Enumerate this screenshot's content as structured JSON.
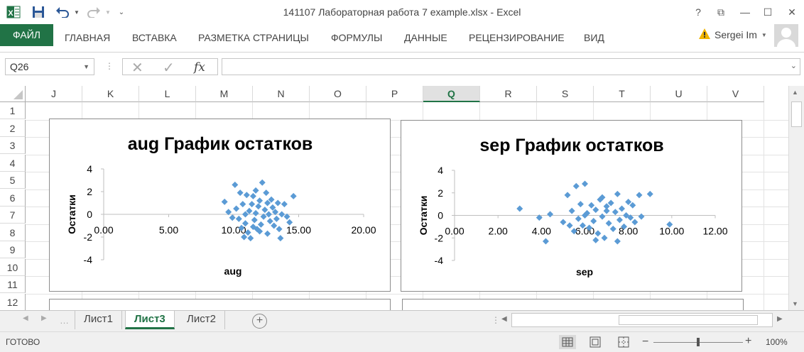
{
  "window": {
    "title": "141107 Лабораторная работа 7 example.xlsx - Excel",
    "help": "?",
    "restore_ribbon": "⧉",
    "minimize": "—",
    "maximize": "☐",
    "close": "✕"
  },
  "quick_access": {
    "excel_icon": "x-icon",
    "save_icon": "save-icon",
    "undo_icon": "undo-icon",
    "redo_icon": "redo-icon"
  },
  "ribbon": {
    "file": "ФАЙЛ",
    "tabs": [
      "ГЛАВНАЯ",
      "ВСТАВКА",
      "РАЗМЕТКА СТРАНИЦЫ",
      "ФОРМУЛЫ",
      "ДАННЫЕ",
      "РЕЦЕНЗИРОВАНИЕ",
      "ВИД"
    ],
    "user": "Sergei Im"
  },
  "formula_bar": {
    "name_box": "Q26",
    "fx": "fx",
    "value": ""
  },
  "grid": {
    "columns": [
      "J",
      "K",
      "L",
      "M",
      "N",
      "O",
      "P",
      "Q",
      "R",
      "S",
      "T",
      "U",
      "V"
    ],
    "selected_column": "Q",
    "rows": [
      "1",
      "2",
      "3",
      "4",
      "5",
      "6",
      "7",
      "8",
      "9",
      "10",
      "11",
      "12"
    ]
  },
  "chart_data": [
    {
      "type": "scatter",
      "title": "aug График остатков",
      "xlabel": "aug",
      "ylabel": "Остатки",
      "xlim": [
        0,
        20
      ],
      "ylim": [
        -4,
        4
      ],
      "xticks": [
        "0.00",
        "5.00",
        "10.00",
        "15.00",
        "20.00"
      ],
      "yticks": [
        "4",
        "2",
        "0",
        "-2",
        "-4"
      ],
      "color": "#5b9bd5",
      "points": [
        [
          9.3,
          1.1
        ],
        [
          9.6,
          0.2
        ],
        [
          9.9,
          -0.3
        ],
        [
          10.1,
          2.6
        ],
        [
          10.2,
          0.5
        ],
        [
          10.4,
          -0.4
        ],
        [
          10.5,
          1.9
        ],
        [
          10.6,
          -1.2
        ],
        [
          10.7,
          0.9
        ],
        [
          10.8,
          -2.0
        ],
        [
          10.9,
          -0.8
        ],
        [
          11.0,
          1.7
        ],
        [
          11.1,
          -1.6
        ],
        [
          11.2,
          0.3
        ],
        [
          11.3,
          -2.1
        ],
        [
          11.4,
          0.9
        ],
        [
          11.5,
          1.6
        ],
        [
          11.6,
          -0.5
        ],
        [
          11.7,
          0.1
        ],
        [
          11.8,
          -1.3
        ],
        [
          11.9,
          0.7
        ],
        [
          12.0,
          1.2
        ],
        [
          12.1,
          -0.9
        ],
        [
          12.2,
          2.8
        ],
        [
          12.3,
          -0.2
        ],
        [
          12.4,
          0.4
        ],
        [
          12.5,
          1.9
        ],
        [
          12.6,
          -1.7
        ],
        [
          12.7,
          0.0
        ],
        [
          12.8,
          -0.6
        ],
        [
          12.9,
          1.3
        ],
        [
          13.0,
          0.6
        ],
        [
          13.1,
          -1.0
        ],
        [
          13.2,
          0.2
        ],
        [
          13.3,
          -0.4
        ],
        [
          13.4,
          1.0
        ],
        [
          13.5,
          -1.3
        ],
        [
          13.6,
          -2.1
        ],
        [
          13.7,
          0.0
        ],
        [
          13.9,
          0.9
        ],
        [
          14.1,
          -0.2
        ],
        [
          14.3,
          -0.7
        ],
        [
          14.6,
          1.6
        ],
        [
          11.5,
          -1.1
        ],
        [
          12.0,
          -1.5
        ],
        [
          10.9,
          0.0
        ],
        [
          11.7,
          2.1
        ],
        [
          12.6,
          1.0
        ]
      ]
    },
    {
      "type": "scatter",
      "title": "sep График остатков",
      "xlabel": "sep",
      "ylabel": "Остатки",
      "xlim": [
        0,
        12
      ],
      "ylim": [
        -4,
        4
      ],
      "xticks": [
        "0.00",
        "2.00",
        "4.00",
        "6.00",
        "8.00",
        "10.00",
        "12.00"
      ],
      "yticks": [
        "4",
        "2",
        "0",
        "-2",
        "-4"
      ],
      "color": "#5b9bd5",
      "points": [
        [
          3.0,
          0.6
        ],
        [
          3.9,
          -0.2
        ],
        [
          4.2,
          -2.3
        ],
        [
          4.4,
          0.1
        ],
        [
          5.0,
          -0.6
        ],
        [
          5.2,
          1.8
        ],
        [
          5.4,
          0.4
        ],
        [
          5.5,
          -1.4
        ],
        [
          5.6,
          2.6
        ],
        [
          5.7,
          -0.3
        ],
        [
          5.8,
          1.0
        ],
        [
          5.9,
          -0.9
        ],
        [
          6.0,
          2.8
        ],
        [
          6.1,
          0.2
        ],
        [
          6.2,
          -1.1
        ],
        [
          6.3,
          0.9
        ],
        [
          6.4,
          -0.5
        ],
        [
          6.5,
          0.5
        ],
        [
          6.6,
          -1.6
        ],
        [
          6.7,
          1.4
        ],
        [
          6.8,
          -0.1
        ],
        [
          6.9,
          -2.0
        ],
        [
          7.0,
          0.8
        ],
        [
          7.1,
          -0.7
        ],
        [
          7.2,
          1.1
        ],
        [
          7.3,
          -1.2
        ],
        [
          7.4,
          0.3
        ],
        [
          7.5,
          1.9
        ],
        [
          7.6,
          -0.4
        ],
        [
          7.7,
          0.6
        ],
        [
          7.8,
          -1.0
        ],
        [
          7.9,
          0.0
        ],
        [
          8.0,
          1.2
        ],
        [
          8.1,
          -0.2
        ],
        [
          8.2,
          0.9
        ],
        [
          8.3,
          -0.6
        ],
        [
          8.5,
          1.8
        ],
        [
          8.6,
          -0.1
        ],
        [
          9.0,
          1.9
        ],
        [
          9.9,
          -0.8
        ],
        [
          6.5,
          -2.2
        ],
        [
          7.5,
          -2.3
        ],
        [
          6.0,
          0.0
        ],
        [
          7.0,
          0.4
        ],
        [
          5.3,
          -0.9
        ],
        [
          6.8,
          1.6
        ]
      ]
    }
  ],
  "sheets": {
    "tabs": [
      "Лист1",
      "Лист3",
      "Лист2"
    ],
    "active": "Лист3",
    "add": "+"
  },
  "status": {
    "ready": "ГОТОВО",
    "zoom": "100%"
  }
}
